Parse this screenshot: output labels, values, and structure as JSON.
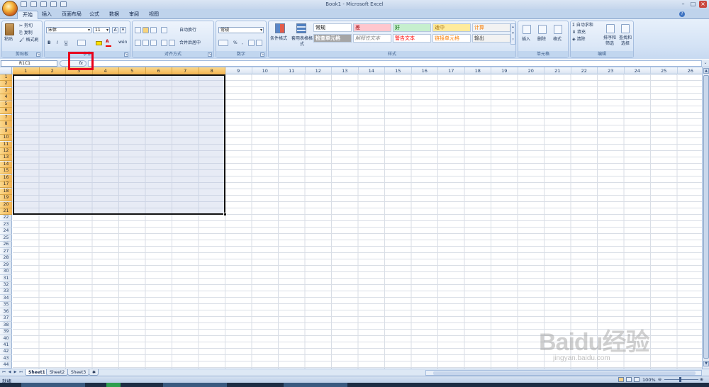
{
  "window": {
    "title": "Book1 - Microsoft Excel"
  },
  "tabs": [
    "开始",
    "插入",
    "页面布局",
    "公式",
    "数据",
    "审阅",
    "视图"
  ],
  "ribbon": {
    "clipboard": {
      "paste": "粘贴",
      "cut": "剪切",
      "copy": "复制",
      "format_painter": "格式刷",
      "label": "剪贴板"
    },
    "font": {
      "name": "宋体",
      "size": "11",
      "bold": "B",
      "italic": "I",
      "underline": "U",
      "label": "字体"
    },
    "alignment": {
      "wrap": "自动换行",
      "merge": "合并后居中",
      "label": "对齐方式"
    },
    "number": {
      "format": "常规",
      "percent": "%",
      "label": "数字"
    },
    "styles": {
      "conditional": "条件格式",
      "table": "套用表格格式",
      "label": "样式",
      "cells": [
        {
          "text": "常规",
          "bg": "#ffffff",
          "fg": "#000000"
        },
        {
          "text": "差",
          "bg": "#ffc7ce",
          "fg": "#9c0006"
        },
        {
          "text": "好",
          "bg": "#c6efce",
          "fg": "#006100"
        },
        {
          "text": "适中",
          "bg": "#ffeb9c",
          "fg": "#9c6500"
        },
        {
          "text": "计算",
          "bg": "#f2f2f2",
          "fg": "#fa7d00"
        },
        {
          "text": "检查单元格",
          "bg": "#a5a5a5",
          "fg": "#ffffff"
        },
        {
          "text": "解释性文本",
          "bg": "#ffffff",
          "fg": "#7f7f7f"
        },
        {
          "text": "警告文本",
          "bg": "#ffffff",
          "fg": "#ff0000"
        },
        {
          "text": "链接单元格",
          "bg": "#ffffff",
          "fg": "#fa7d00"
        },
        {
          "text": "输出",
          "bg": "#f2f2f2",
          "fg": "#3f3f3f"
        }
      ]
    },
    "cells_group": {
      "insert": "插入",
      "delete": "删除",
      "format": "格式",
      "label": "单元格"
    },
    "editing": {
      "autosum": "自动求和",
      "fill": "填充",
      "clear": "清除",
      "sort": "排序和筛选",
      "find": "查找和选择",
      "label": "编辑"
    }
  },
  "formula_bar": {
    "name_box": "R1C1",
    "fx": "fx",
    "value": ""
  },
  "columns": [
    "1",
    "2",
    "3",
    "4",
    "5",
    "6",
    "7",
    "8",
    "9",
    "10",
    "11",
    "12",
    "13",
    "14",
    "15",
    "16",
    "17",
    "18",
    "19",
    "20",
    "21",
    "22",
    "23",
    "24",
    "25",
    "26"
  ],
  "rows": [
    "1",
    "2",
    "3",
    "4",
    "5",
    "6",
    "7",
    "8",
    "9",
    "10",
    "11",
    "12",
    "13",
    "14",
    "15",
    "16",
    "17",
    "18",
    "19",
    "20",
    "21",
    "22",
    "23",
    "24",
    "25",
    "26",
    "27",
    "28",
    "29",
    "30",
    "31",
    "32",
    "33",
    "34",
    "35",
    "36",
    "37",
    "38",
    "39",
    "40",
    "41",
    "42",
    "43",
    "44"
  ],
  "selection": {
    "from_col": 1,
    "to_col": 8,
    "from_row": 1,
    "to_row": 21
  },
  "sheets": [
    "Sheet1",
    "Sheet2",
    "Sheet3"
  ],
  "status": {
    "ready": "就绪",
    "zoom": "100%"
  },
  "watermark": {
    "logo": "Baidu经验",
    "url": "jingyan.baidu.com"
  }
}
